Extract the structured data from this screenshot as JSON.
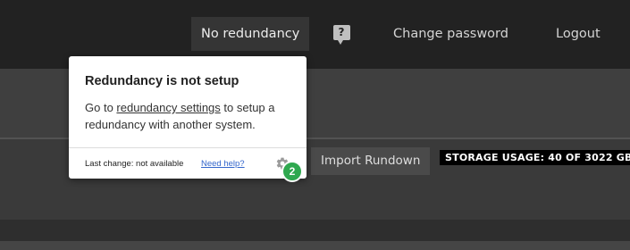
{
  "topbar": {
    "redundancy_label": "No redundancy",
    "help_glyph": "?",
    "help_icon": "help-speech-bubble-icon",
    "change_password_label": "Change password",
    "logout_label": "Logout"
  },
  "toolbar": {
    "import_label": "Import Rundown",
    "storage_label": "STORAGE USAGE: 40 OF 3022 GB"
  },
  "popover": {
    "title": "Redundancy is not setup",
    "body_prefix": "Go to",
    "body_link": "redundancy settings",
    "body_suffix": "to setup a redundancy with another system.",
    "last_change": "Last change: not available",
    "help_link": "Need help?",
    "gear_icon": "gear-icon"
  },
  "step_badge": "2",
  "colors": {
    "topbar_bg": "#222222",
    "link_blue": "#3366cc",
    "badge_green": "#2fa84f"
  }
}
